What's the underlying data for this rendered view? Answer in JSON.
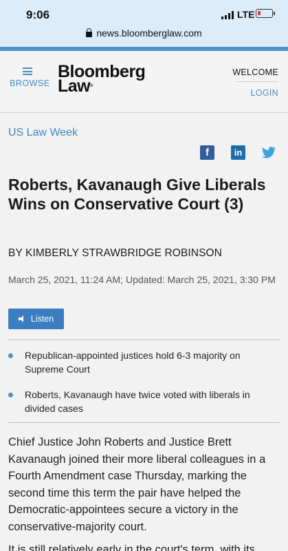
{
  "status_bar": {
    "time": "9:06",
    "network": "LTE",
    "url": "news.bloomberglaw.com"
  },
  "header": {
    "browse_label": "BROWSE",
    "logo_line1": "Bloomberg",
    "logo_line2": "Law",
    "welcome_label": "WELCOME",
    "login_label": "LOGIN"
  },
  "article": {
    "kicker": "US Law Week",
    "social": {
      "facebook": "f",
      "linkedin": "in",
      "twitter": "🐦"
    },
    "headline": "Roberts, Kavanaugh Give Liberals Wins on Conservative Court (3)",
    "byline": "BY KIMBERLY STRAWBRIDGE ROBINSON",
    "dateline": "March 25, 2021, 11:24 AM; Updated: March 25, 2021, 3:30 PM",
    "listen_label": "Listen",
    "bullets": [
      "Republican-appointed justices hold 6-3 majority on Supreme Court",
      "Roberts, Kavanaugh have twice voted with liberals in divided cases"
    ],
    "body": "Chief Justice John Roberts and Justice Brett Kavanaugh joined their more liberal colleagues in a Fourth Amendment case Thursday, marking the second time this term the pair have helped the Democratic-appointees secure a victory in the conservative-majority court.",
    "body_partial": "It is still relatively early in the court's term, with its"
  },
  "colors": {
    "accent": "#3f88c5",
    "facebook": "#355b9c",
    "linkedin": "#1c6ea8",
    "twitter": "#3ea3e2"
  }
}
